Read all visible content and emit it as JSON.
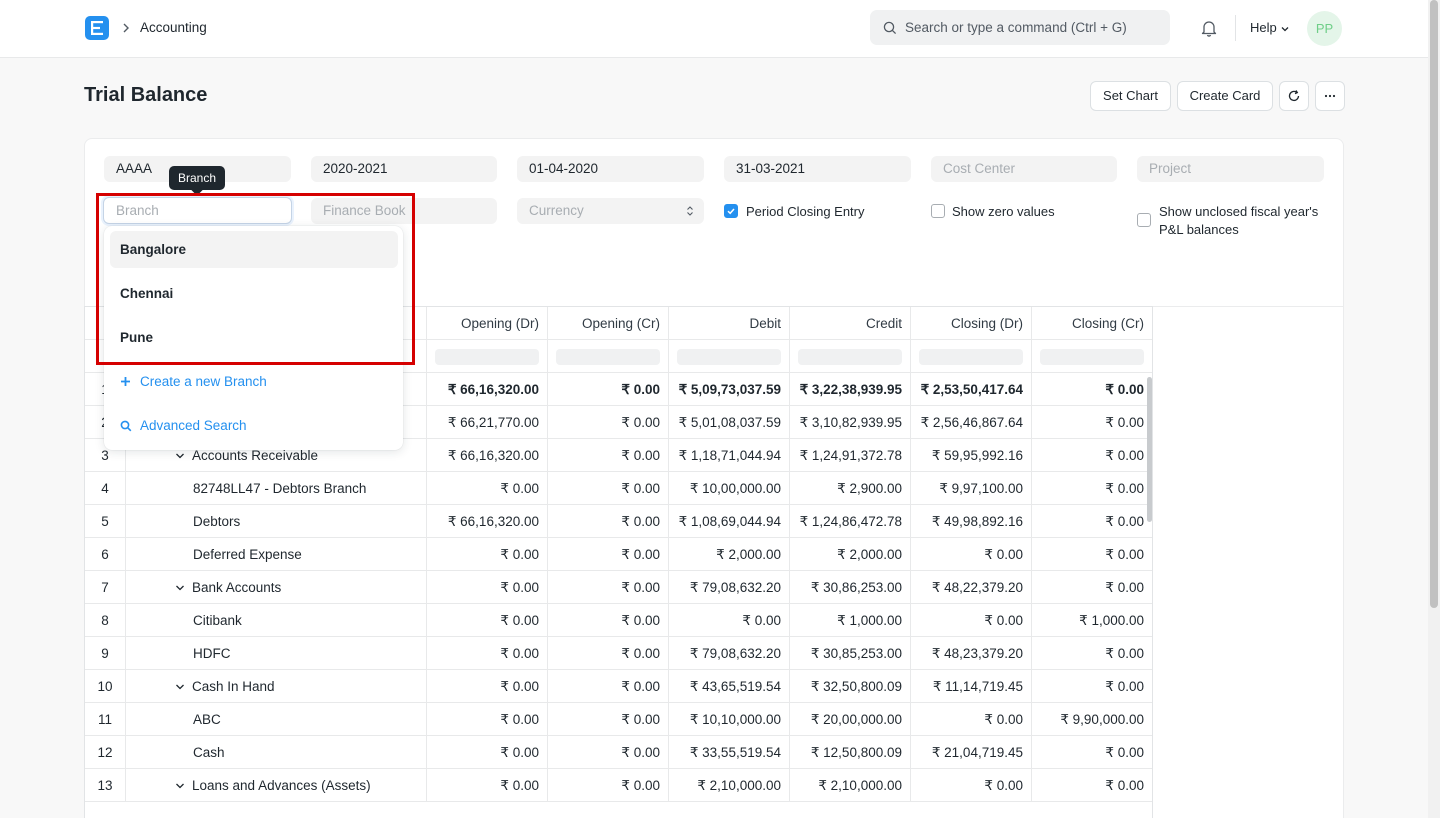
{
  "navbar": {
    "breadcrumb": "Accounting",
    "search_placeholder": "Search or type a command (Ctrl + G)",
    "help_label": "Help",
    "avatar_initials": "PP"
  },
  "page": {
    "title": "Trial Balance",
    "set_chart_label": "Set Chart",
    "create_card_label": "Create Card",
    "more_label": "..."
  },
  "filters": {
    "company": "AAAA",
    "fiscal_year": "2020-2021",
    "from_date": "01-04-2020",
    "to_date": "31-03-2021",
    "cost_center_placeholder": "Cost Center",
    "project_placeholder": "Project",
    "branch_placeholder": "Branch",
    "finance_book_placeholder": "Finance Book",
    "currency_placeholder": "Currency",
    "period_closing_label": "Period Closing Entry",
    "period_closing_checked": true,
    "show_zero_label": "Show zero values",
    "show_unclosed_label_1": "Show unclosed fiscal year's",
    "show_unclosed_label_2": "P&L balances"
  },
  "branch_dropdown": {
    "tooltip": "Branch",
    "options": [
      "Bangalore",
      "Chennai",
      "Pune"
    ],
    "create_new": "Create a new Branch",
    "advanced_search": "Advanced Search"
  },
  "table": {
    "columns": [
      "Opening (Dr)",
      "Opening (Cr)",
      "Debit",
      "Credit",
      "Closing (Dr)",
      "Closing (Cr)"
    ],
    "rows": [
      {
        "idx": "1",
        "account": "",
        "values": [
          "₹ 66,16,320.00",
          "₹ 0.00",
          "₹ 5,09,73,037.59",
          "₹ 3,22,38,939.95",
          "₹ 2,53,50,417.64",
          "₹ 0.00"
        ],
        "bold": true
      },
      {
        "idx": "2",
        "account": "",
        "values": [
          "₹ 66,21,770.00",
          "₹ 0.00",
          "₹ 5,01,08,037.59",
          "₹ 3,10,82,939.95",
          "₹ 2,56,46,867.64",
          "₹ 0.00"
        ]
      },
      {
        "idx": "3",
        "account": "Accounts Receivable",
        "group": true,
        "values": [
          "₹ 66,16,320.00",
          "₹ 0.00",
          "₹ 1,18,71,044.94",
          "₹ 1,24,91,372.78",
          "₹ 59,95,992.16",
          "₹ 0.00"
        ]
      },
      {
        "idx": "4",
        "account": "82748LL47 - Debtors Branch",
        "values": [
          "₹ 0.00",
          "₹ 0.00",
          "₹ 10,00,000.00",
          "₹ 2,900.00",
          "₹ 9,97,100.00",
          "₹ 0.00"
        ]
      },
      {
        "idx": "5",
        "account": "Debtors",
        "values": [
          "₹ 66,16,320.00",
          "₹ 0.00",
          "₹ 1,08,69,044.94",
          "₹ 1,24,86,472.78",
          "₹ 49,98,892.16",
          "₹ 0.00"
        ]
      },
      {
        "idx": "6",
        "account": "Deferred Expense",
        "values": [
          "₹ 0.00",
          "₹ 0.00",
          "₹ 2,000.00",
          "₹ 2,000.00",
          "₹ 0.00",
          "₹ 0.00"
        ]
      },
      {
        "idx": "7",
        "account": "Bank Accounts",
        "group": true,
        "values": [
          "₹ 0.00",
          "₹ 0.00",
          "₹ 79,08,632.20",
          "₹ 30,86,253.00",
          "₹ 48,22,379.20",
          "₹ 0.00"
        ]
      },
      {
        "idx": "8",
        "account": "Citibank",
        "values": [
          "₹ 0.00",
          "₹ 0.00",
          "₹ 0.00",
          "₹ 1,000.00",
          "₹ 0.00",
          "₹ 1,000.00"
        ]
      },
      {
        "idx": "9",
        "account": "HDFC",
        "values": [
          "₹ 0.00",
          "₹ 0.00",
          "₹ 79,08,632.20",
          "₹ 30,85,253.00",
          "₹ 48,23,379.20",
          "₹ 0.00"
        ]
      },
      {
        "idx": "10",
        "account": "Cash In Hand",
        "group": true,
        "values": [
          "₹ 0.00",
          "₹ 0.00",
          "₹ 43,65,519.54",
          "₹ 32,50,800.09",
          "₹ 11,14,719.45",
          "₹ 0.00"
        ]
      },
      {
        "idx": "11",
        "account": "ABC",
        "values": [
          "₹ 0.00",
          "₹ 0.00",
          "₹ 10,10,000.00",
          "₹ 20,00,000.00",
          "₹ 0.00",
          "₹ 9,90,000.00"
        ]
      },
      {
        "idx": "12",
        "account": "Cash",
        "values": [
          "₹ 0.00",
          "₹ 0.00",
          "₹ 33,55,519.54",
          "₹ 12,50,800.09",
          "₹ 21,04,719.45",
          "₹ 0.00"
        ]
      },
      {
        "idx": "13",
        "account": "Loans and Advances (Assets)",
        "group": true,
        "values": [
          "₹ 0.00",
          "₹ 0.00",
          "₹ 2,10,000.00",
          "₹ 2,10,000.00",
          "₹ 0.00",
          "₹ 0.00"
        ]
      }
    ]
  },
  "colors": {
    "accent": "#2490ef",
    "highlight": "#d50000",
    "avatar_bg": "#e4f5e9",
    "avatar_fg": "#6fce88"
  }
}
